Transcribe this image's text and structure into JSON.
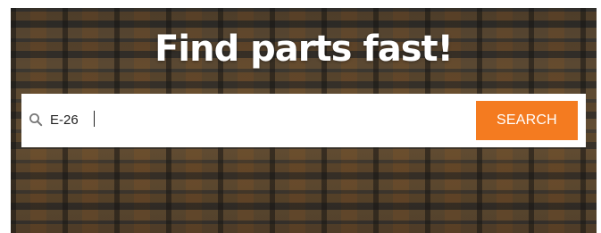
{
  "hero": {
    "headline": "Find parts fast!"
  },
  "search": {
    "value": "E-26",
    "icon": "search-icon",
    "button_label": "SEARCH"
  },
  "colors": {
    "accent": "#f47b20",
    "headline": "#ffffff",
    "search_box_bg": "#ffffff"
  }
}
